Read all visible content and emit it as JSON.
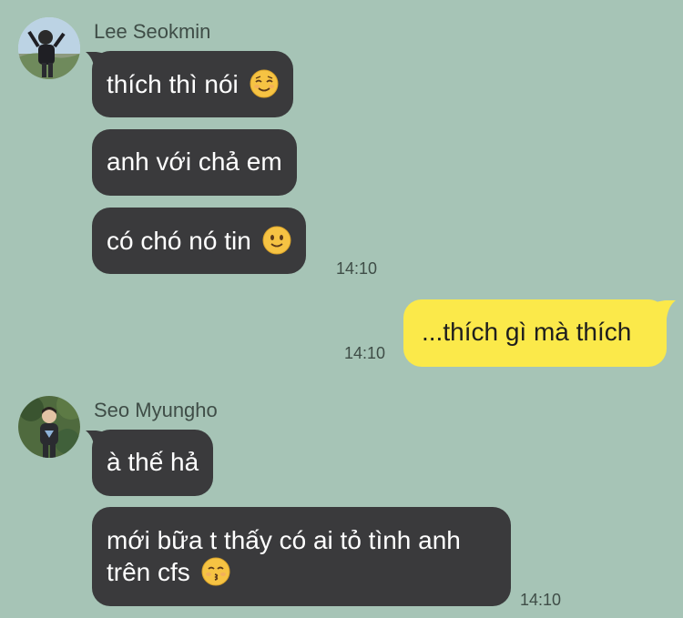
{
  "chat": {
    "groups": [
      {
        "sender": "Lee Seokmin",
        "messages": [
          {
            "text": "thích thì nói",
            "emoji": "relieved-face-emoji"
          },
          {
            "text": "anh với chả em"
          },
          {
            "text": "có chó nó tin",
            "emoji": "slightly-smiling-face-emoji"
          }
        ],
        "time": "14:10"
      },
      {
        "outgoing": true,
        "messages": [
          {
            "text": "...thích gì mà thích"
          }
        ],
        "time": "14:10"
      },
      {
        "sender": "Seo Myungho",
        "messages": [
          {
            "text": "à thế hả"
          },
          {
            "text": "mới bữa t thấy có ai tỏ tình anh trên cfs",
            "emoji": "kissing-face-emoji"
          }
        ],
        "time": "14:10"
      }
    ]
  },
  "colors": {
    "background": "#a6c4b6",
    "incoming_bubble": "#3a3a3c",
    "outgoing_bubble": "#fbe94a",
    "meta_text": "#3f4d47"
  }
}
